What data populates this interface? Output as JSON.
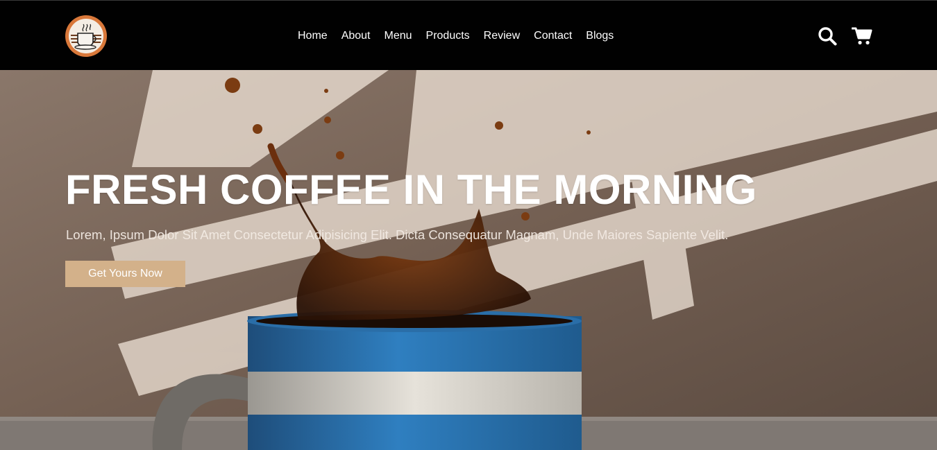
{
  "header": {
    "logo_icon": "coffee-cup-logo-icon",
    "nav": [
      {
        "label": "Home"
      },
      {
        "label": "About"
      },
      {
        "label": "Menu"
      },
      {
        "label": "Products"
      },
      {
        "label": "Review"
      },
      {
        "label": "Contact"
      },
      {
        "label": "Blogs"
      }
    ],
    "search_icon": "search-icon",
    "cart_icon": "shopping-cart-icon"
  },
  "hero": {
    "title": "FRESH COFFEE IN THE MORNING",
    "subtitle": "Lorem, Ipsum Dolor Sit Amet Consectetur Adipisicing Elit. Dicta Consequatur Magnam, Unde Maiores Sapiente Velit.",
    "cta_label": "Get Yours Now",
    "background_image": "coffee-splash-mug-photo"
  },
  "colors": {
    "header_bg": "#010101",
    "cta_bg": "#d3b18a",
    "text": "#ffffff",
    "logo_ring": "#d9783a"
  }
}
